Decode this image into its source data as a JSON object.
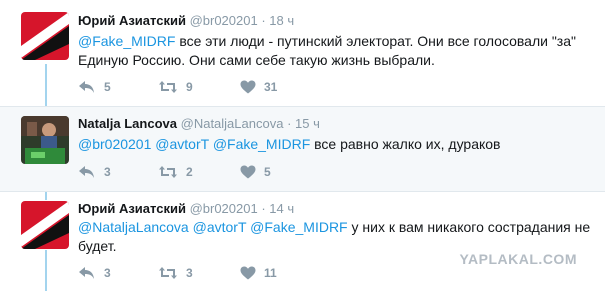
{
  "tweets": [
    {
      "fullname": "Юрий Азиатский",
      "handle": "@br020201",
      "dot": "·",
      "time": "18 ч",
      "body": [
        {
          "t": "@Fake_MIDRF",
          "m": true
        },
        {
          "t": " все эти люди - путинский электорат. Они все голосовали \"за\" Единую Россию. Они сами себе такую жизнь выбрали.",
          "m": false
        }
      ],
      "actions": {
        "reply": "5",
        "retweet": "9",
        "like": "31"
      }
    },
    {
      "fullname": "Natalja Lancova",
      "handle": "@NataljaLancova",
      "dot": "·",
      "time": "15 ч",
      "body": [
        {
          "t": "@br020201",
          "m": true
        },
        {
          "t": " ",
          "m": false
        },
        {
          "t": "@avtorT",
          "m": true
        },
        {
          "t": " ",
          "m": false
        },
        {
          "t": "@Fake_MIDRF",
          "m": true
        },
        {
          "t": " все равно жалко их, дураков",
          "m": false
        }
      ],
      "actions": {
        "reply": "3",
        "retweet": "2",
        "like": "5"
      }
    },
    {
      "fullname": "Юрий Азиатский",
      "handle": "@br020201",
      "dot": "·",
      "time": "14 ч",
      "body": [
        {
          "t": "@NataljaLancova",
          "m": true
        },
        {
          "t": " ",
          "m": false
        },
        {
          "t": "@avtorT",
          "m": true
        },
        {
          "t": " ",
          "m": false
        },
        {
          "t": "@Fake_MIDRF",
          "m": true
        },
        {
          "t": " у них к вам никакого сострадания не будет.",
          "m": false
        }
      ],
      "actions": {
        "reply": "3",
        "retweet": "3",
        "like": "11"
      }
    }
  ],
  "watermark": "YAPLAKAL.COM",
  "colors": {
    "mention": "#1b95e0",
    "meta": "#8899a6",
    "thread": "#a3d4ee",
    "avatar_red": "#d6152b"
  }
}
